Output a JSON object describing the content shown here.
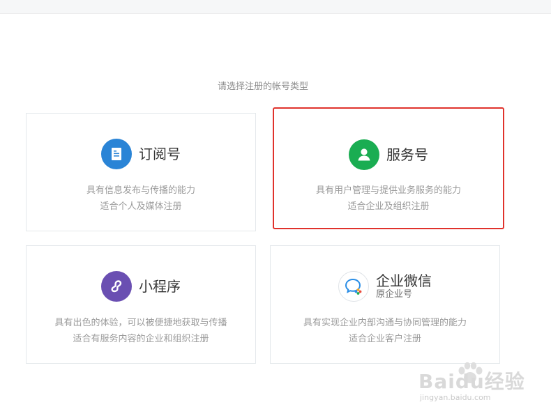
{
  "prompt": "请选择注册的帐号类型",
  "cards": [
    {
      "title": "订阅号",
      "subtitle": "",
      "desc": [
        "具有信息发布与传播的能力",
        "适合个人及媒体注册"
      ],
      "icon": "document-icon",
      "icon_color": "#2a84d6"
    },
    {
      "title": "服务号",
      "subtitle": "",
      "desc": [
        "具有用户管理与提供业务服务的能力",
        "适合企业及组织注册"
      ],
      "icon": "user-icon",
      "icon_color": "#1aad52",
      "highlight_color": "#e0322c"
    },
    {
      "title": "小程序",
      "subtitle": "",
      "desc": [
        "具有出色的体验，可以被便捷地获取与传播",
        "适合有服务内容的企业和组织注册"
      ],
      "icon": "miniprogram-icon",
      "icon_color": "#6a4fb2"
    },
    {
      "title": "企业微信",
      "subtitle": "原企业号",
      "desc": [
        "具有实现企业内部沟通与协同管理的能力",
        "适合企业客户注册"
      ],
      "icon": "wecom-icon",
      "icon_color": "#2a84d6"
    }
  ],
  "watermark": {
    "main": "Baidu经验",
    "sub": "jingyan.baidu.com"
  }
}
